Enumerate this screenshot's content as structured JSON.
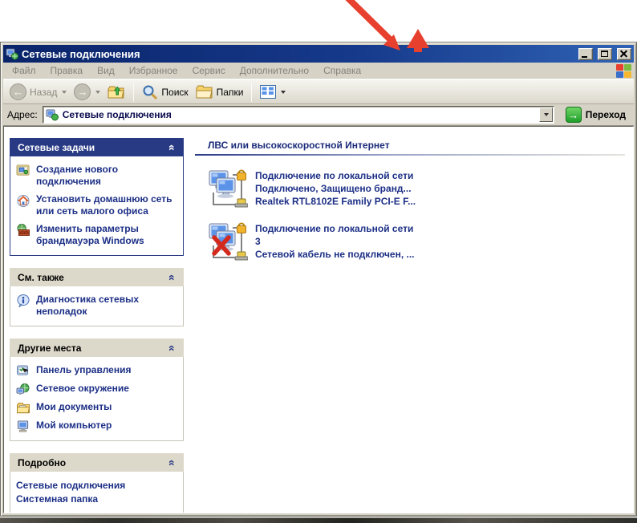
{
  "window": {
    "title": "Сетевые подключения"
  },
  "menu": {
    "items": [
      "Файл",
      "Правка",
      "Вид",
      "Избранное",
      "Сервис",
      "Дополнительно",
      "Справка"
    ]
  },
  "toolbar": {
    "back_label": "Назад",
    "search_label": "Поиск",
    "folders_label": "Папки"
  },
  "addressbar": {
    "label": "Адрес:",
    "value": "Сетевые подключения",
    "go_label": "Переход"
  },
  "sidebar": {
    "panels": [
      {
        "title": "Сетевые задачи",
        "items": [
          {
            "icon": "new-connection-icon",
            "label": "Создание нового подключения"
          },
          {
            "icon": "home-network-icon",
            "label": "Установить домашнюю сеть или сеть малого офиса"
          },
          {
            "icon": "firewall-icon",
            "label": "Изменить параметры брандмауэра Windows"
          }
        ]
      },
      {
        "title": "См. также",
        "items": [
          {
            "icon": "info-icon",
            "label": "Диагностика сетевых неполадок"
          }
        ]
      },
      {
        "title": "Другие места",
        "items": [
          {
            "icon": "control-panel-icon",
            "label": "Панель управления"
          },
          {
            "icon": "network-places-icon",
            "label": "Сетевое окружение"
          },
          {
            "icon": "my-documents-icon",
            "label": "Мои документы"
          },
          {
            "icon": "my-computer-icon",
            "label": "Мой компьютер"
          }
        ]
      },
      {
        "title": "Подробно",
        "lines": [
          "Сетевые подключения",
          "Системная папка"
        ]
      }
    ]
  },
  "main": {
    "group_header": "ЛВС или высокоскоростной Интернет",
    "connections": [
      {
        "lines": [
          "Подключение по локальной сети",
          "Подключено, Защищено бранд...",
          "Realtek RTL8102E Family PCI-E F..."
        ],
        "state": "connected-firewalled"
      },
      {
        "lines": [
          "Подключение по локальной сети",
          "3",
          "Сетевой кабель не подключен, ..."
        ],
        "state": "cable-unplugged"
      }
    ]
  },
  "icons": {
    "chevron": "«",
    "back_arrow": "←",
    "forward_arrow": "→",
    "go_arrow": "→"
  },
  "colors": {
    "titlebar_start": "#0a246a",
    "titlebar_end": "#2f62b4",
    "chrome": "#d6d2c6",
    "panel_header_navy": "#293a85",
    "link_navy": "#1c2f86",
    "annotation_red": "#e8402e",
    "go_green": "#1f9e2a"
  }
}
